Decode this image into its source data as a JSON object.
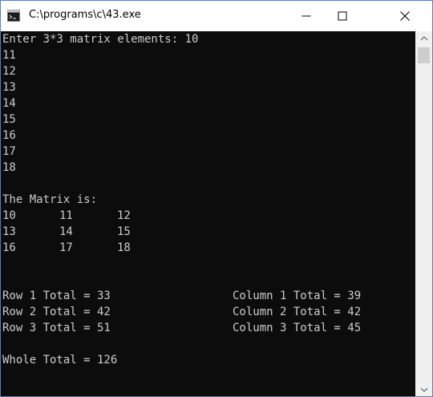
{
  "window": {
    "title": "C:\\programs\\c\\43.exe"
  },
  "console": {
    "prompt_line": "Enter 3*3 matrix elements: 10",
    "inputs": [
      "11",
      "12",
      "13",
      "14",
      "15",
      "16",
      "17",
      "18"
    ],
    "matrix_heading": "The Matrix is:",
    "matrix": [
      [
        "10",
        "11",
        "12"
      ],
      [
        "13",
        "14",
        "15"
      ],
      [
        "16",
        "17",
        "18"
      ]
    ],
    "row_totals": [
      "Row 1 Total = 33",
      "Row 2 Total = 42",
      "Row 3 Total = 51"
    ],
    "column_totals": [
      "Column 1 Total = 39",
      "Column 2 Total = 42",
      "Column 3 Total = 45"
    ],
    "whole_total": "Whole Total = 126"
  },
  "colors": {
    "console_background": "#0c0c0c",
    "console_text": "#cccccc",
    "titlebar": "#ffffff",
    "window_border": "#5a7fb0"
  },
  "icons": {
    "app": "console-app-icon",
    "minimize": "minimize-icon",
    "maximize": "maximize-icon",
    "close": "close-icon"
  }
}
